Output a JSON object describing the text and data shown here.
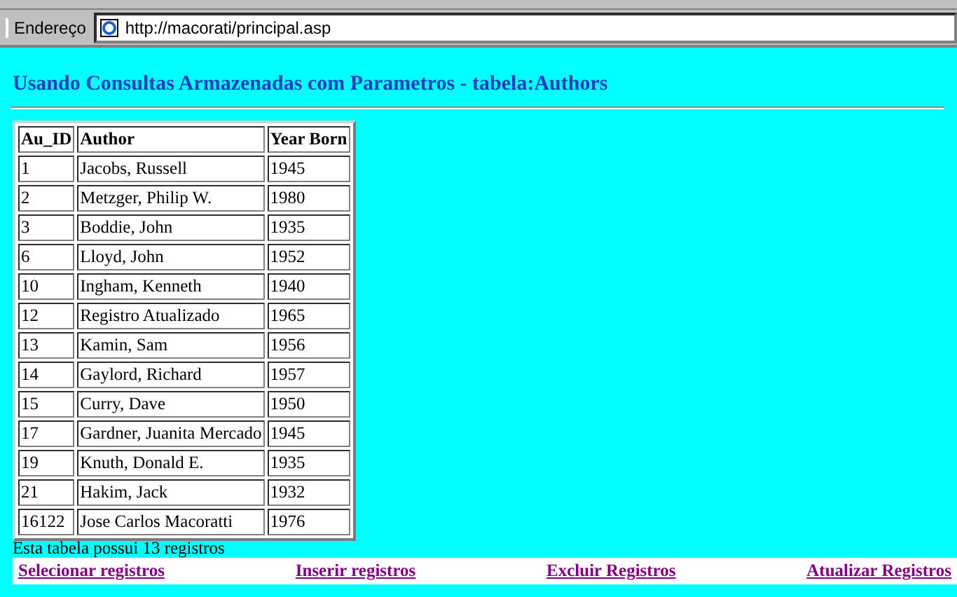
{
  "address_bar": {
    "label": "Endereço",
    "url": "http://macorati/principal.asp"
  },
  "heading": "Usando Consultas Armazenadas com Parametros - tabela:Authors",
  "table": {
    "columns": [
      "Au_ID",
      "Author",
      "Year Born"
    ],
    "rows": [
      [
        "1",
        "Jacobs, Russell",
        "1945"
      ],
      [
        "2",
        "Metzger, Philip W.",
        "1980"
      ],
      [
        "3",
        "Boddie, John",
        "1935"
      ],
      [
        "6",
        "Lloyd, John",
        "1952"
      ],
      [
        "10",
        "Ingham, Kenneth",
        "1940"
      ],
      [
        "12",
        "Registro Atualizado",
        "1965"
      ],
      [
        "13",
        "Kamin, Sam",
        "1956"
      ],
      [
        "14",
        "Gaylord, Richard",
        "1957"
      ],
      [
        "15",
        "Curry, Dave",
        "1950"
      ],
      [
        "17",
        "Gardner, Juanita Mercado",
        "1945"
      ],
      [
        "19",
        "Knuth, Donald E.",
        "1935"
      ],
      [
        "21",
        "Hakim, Jack",
        "1932"
      ],
      [
        "16122",
        "Jose Carlos Macoratti",
        "1976"
      ]
    ]
  },
  "record_count": "Esta tabela possui 13 registros",
  "links": [
    "Selecionar registros",
    "Inserir registros",
    "Excluir Registros",
    "Atualizar Registros"
  ]
}
